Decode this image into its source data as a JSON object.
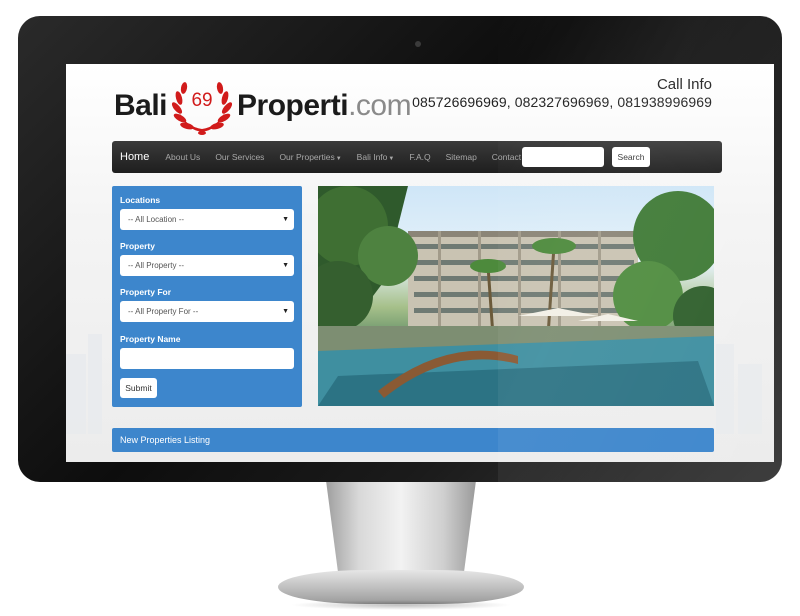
{
  "logo": {
    "part1": "Bali",
    "badge_number": "69",
    "part2": "Properti",
    "part3": ".com"
  },
  "call_info": {
    "title": "Call Info",
    "phones": "085726696969, 082327696969, 081938996969"
  },
  "nav": {
    "items": [
      {
        "label": "Home",
        "active": true,
        "dropdown": false
      },
      {
        "label": "About Us",
        "active": false,
        "dropdown": false
      },
      {
        "label": "Our Services",
        "active": false,
        "dropdown": false
      },
      {
        "label": "Our Properties",
        "active": false,
        "dropdown": true
      },
      {
        "label": "Bali Info",
        "active": false,
        "dropdown": true
      },
      {
        "label": "F.A.Q",
        "active": false,
        "dropdown": false
      },
      {
        "label": "Sitemap",
        "active": false,
        "dropdown": false
      },
      {
        "label": "Contact Us",
        "active": false,
        "dropdown": false
      }
    ],
    "search_value": "",
    "search_button": "Search"
  },
  "search_panel": {
    "locations_label": "Locations",
    "locations_value": "-- All Location --",
    "property_label": "Property",
    "property_value": "-- All Property --",
    "property_for_label": "Property For",
    "property_for_value": "-- All Property For --",
    "property_name_label": "Property Name",
    "property_name_value": "",
    "submit_label": "Submit"
  },
  "listing": {
    "title": "New Properties Listing"
  },
  "colors": {
    "accent_blue": "#3d86cc",
    "navbar_dark": "#222222",
    "logo_red": "#d11b1b"
  }
}
